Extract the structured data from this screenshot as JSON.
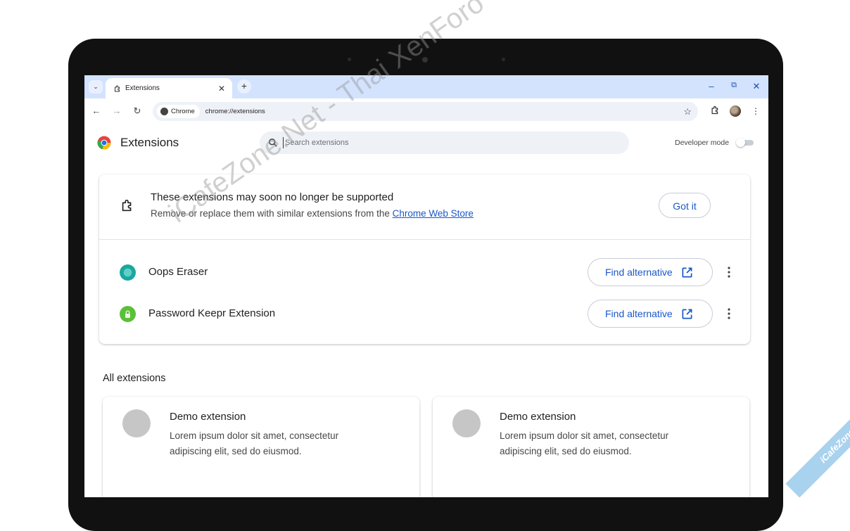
{
  "browser": {
    "tab": {
      "title": "Extensions"
    },
    "omnibox": {
      "chip_label": "Chrome",
      "url": "chrome://extensions"
    }
  },
  "page": {
    "title": "Extensions",
    "search_placeholder": "Search extensions",
    "developer_mode_label": "Developer mode",
    "developer_mode_on": false
  },
  "warning": {
    "title": "These extensions may soon no longer be supported",
    "desc_prefix": "Remove or replace them with similar extensions from the ",
    "link_text": "Chrome Web Store",
    "got_it_label": "Got it",
    "extensions": [
      {
        "name": "Oops Eraser",
        "button_label": "Find alternative",
        "icon_color": "#1aa7a0"
      },
      {
        "name": "Password Keepr Extension",
        "button_label": "Find alternative",
        "icon_color": "#5bbf3a"
      }
    ]
  },
  "all_extensions": {
    "title": "All extensions",
    "items": [
      {
        "name": "Demo extension",
        "description": "Lorem ipsum dolor sit amet, consectetur adipiscing elit, sed do eiusmod."
      },
      {
        "name": "Demo extension",
        "description": "Lorem ipsum dolor sit amet, consectetur adipiscing elit, sed do eiusmod."
      }
    ]
  },
  "overlay": {
    "watermark_text": "iCafeZone.Net - Thai XenForo Community",
    "corner_ribbon_text": "iCafeZone"
  },
  "colors": {
    "accent": "#1a57c8",
    "tabstrip": "#d3e3fd"
  }
}
